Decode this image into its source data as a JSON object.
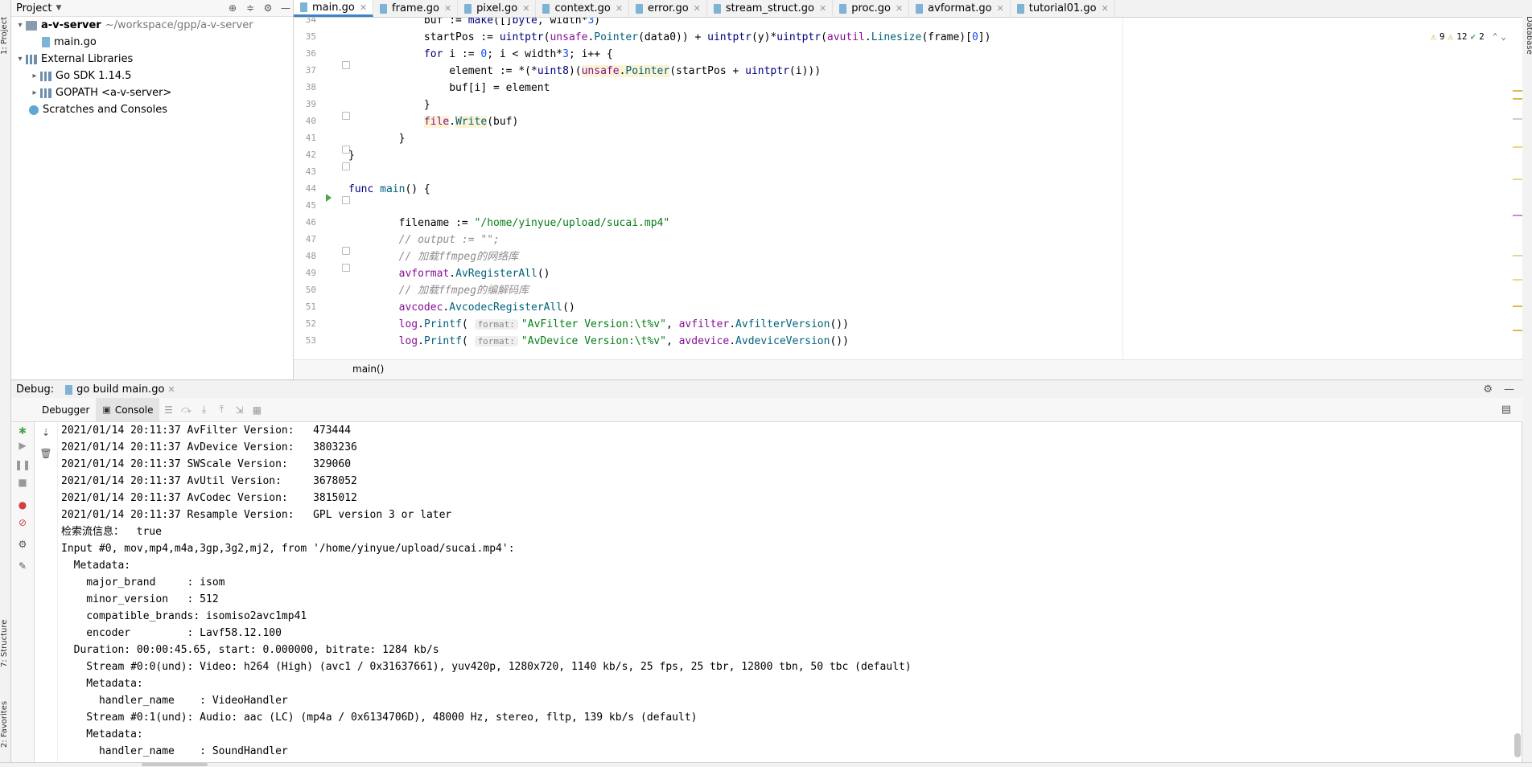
{
  "project_panel": {
    "title": "Project",
    "tree": [
      {
        "label": "a-v-server",
        "path": "~/workspace/gpp/a-v-server",
        "bold": true
      },
      {
        "label": "main.go"
      },
      {
        "label": "External Libraries"
      },
      {
        "label": "Go SDK 1.14.5"
      },
      {
        "label": "GOPATH <a-v-server>"
      },
      {
        "label": "Scratches and Consoles"
      }
    ]
  },
  "left_strip": {
    "project": "1: Project",
    "structure": "7: Structure",
    "favorites": "2: Favorites"
  },
  "right_strip": {
    "database": "Database"
  },
  "tabs": [
    "main.go",
    "frame.go",
    "pixel.go",
    "context.go",
    "error.go",
    "stream_struct.go",
    "proc.go",
    "avformat.go",
    "tutorial01.go"
  ],
  "inspections": {
    "warnings": "9",
    "weak_warnings": "12",
    "ok": "2"
  },
  "editor": {
    "line_numbers": [
      "34",
      "35",
      "36",
      "37",
      "38",
      "39",
      "40",
      "41",
      "42",
      "43",
      "44",
      "45",
      "46",
      "47",
      "48",
      "49",
      "50",
      "51",
      "52",
      "53"
    ],
    "breadcrumb": "main()",
    "strings": {
      "filename": "\"/home/yinyue/upload/sucai.mp4\"",
      "output_comment": "// output := \"\";",
      "comment_net": "// 加载ffmpeg的网络库",
      "comment_codec": "// 加载ffmpeg的编解码库",
      "fmt_filter": "\"AvFilter Version:\\t%v\"",
      "fmt_device": "\"AvDevice Version:\\t%v\"",
      "hint_format": "format:"
    }
  },
  "debug": {
    "label": "Debug:",
    "run_config": "go build main.go",
    "tabs": [
      "Debugger",
      "Console"
    ]
  },
  "console_lines": [
    "2021/01/14 20:11:37 AvFilter Version:   473444",
    "2021/01/14 20:11:37 AvDevice Version:   3803236",
    "2021/01/14 20:11:37 SWScale Version:    329060",
    "2021/01/14 20:11:37 AvUtil Version:     3678052",
    "2021/01/14 20:11:37 AvCodec Version:    3815012",
    "2021/01/14 20:11:37 Resample Version:   GPL version 3 or later",
    "检索流信息：  true",
    "Input #0, mov,mp4,m4a,3gp,3g2,mj2, from '/home/yinyue/upload/sucai.mp4':",
    "  Metadata:",
    "    major_brand     : isom",
    "    minor_version   : 512",
    "    compatible_brands: isomiso2avc1mp41",
    "    encoder         : Lavf58.12.100",
    "  Duration: 00:00:45.65, start: 0.000000, bitrate: 1284 kb/s",
    "    Stream #0:0(und): Video: h264 (High) (avc1 / 0x31637661), yuv420p, 1280x720, 1140 kb/s, 25 fps, 25 tbr, 12800 tbn, 50 tbc (default)",
    "    Metadata:",
    "      handler_name    : VideoHandler",
    "    Stream #0:1(und): Audio: aac (LC) (mp4a / 0x6134706D), 48000 Hz, stereo, fltp, 139 kb/s (default)",
    "    Metadata:",
    "      handler_name    : SoundHandler"
  ]
}
